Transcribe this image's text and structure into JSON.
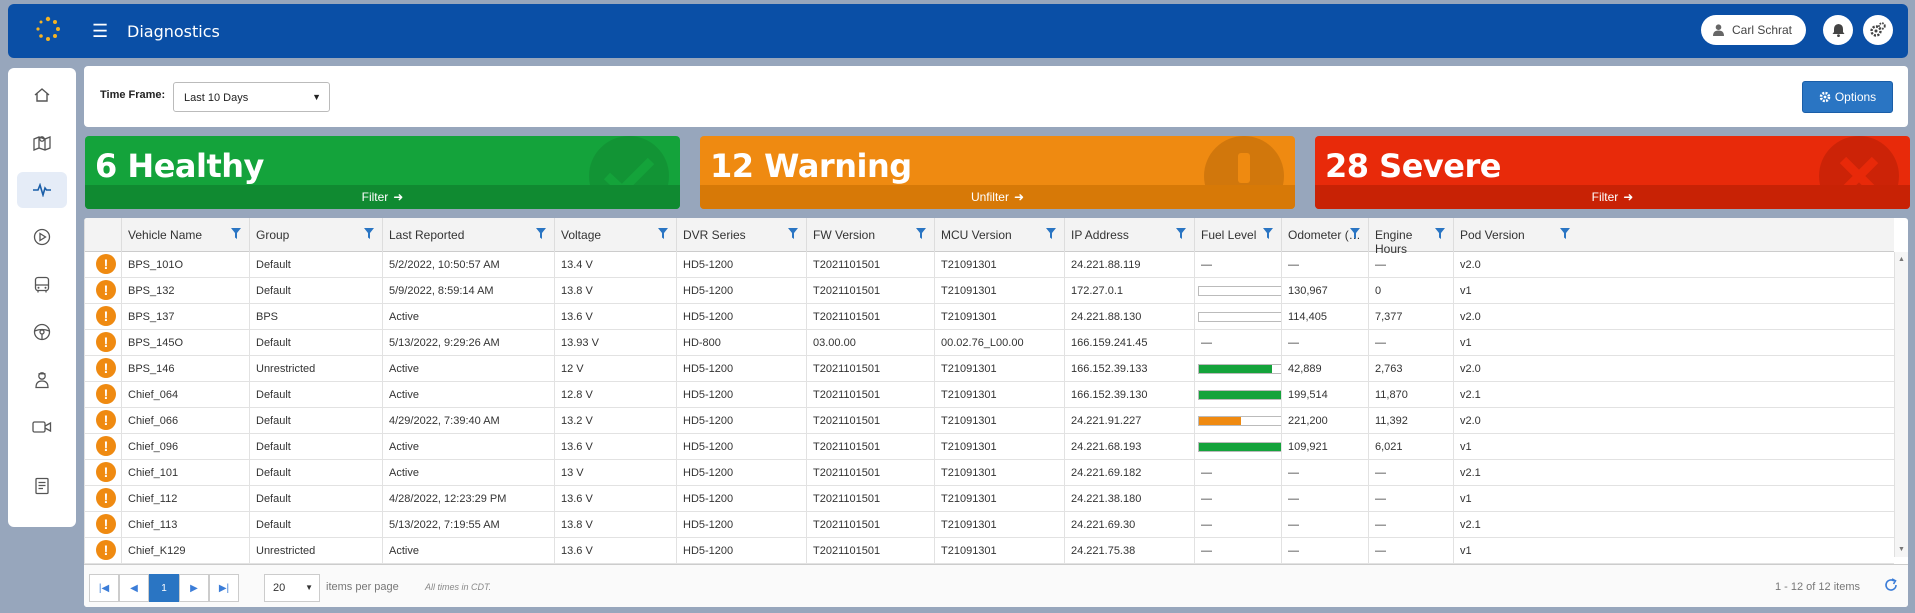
{
  "header": {
    "title": "Diagnostics",
    "user_name": "Carl Schrat",
    "bg": "#0a4fa6"
  },
  "sidebar": {
    "items": [
      "home-icon",
      "map-icon",
      "diagnostics-icon",
      "play-icon",
      "bus-icon",
      "steering-wheel-icon",
      "driver-icon",
      "video-camera-icon",
      "report-icon"
    ],
    "active": "diagnostics-icon"
  },
  "filters": {
    "time_frame_label": "Time Frame:",
    "time_frame_value": "Last 10 Days",
    "options_label": "Options"
  },
  "cards": [
    {
      "title": "6 Healthy",
      "action": "Filter",
      "color": "#14a33b",
      "footer_color": "#108a31"
    },
    {
      "title": "12 Warning",
      "action": "Unfilter",
      "color": "#ef8a11",
      "footer_color": "#d77907"
    },
    {
      "title": "28 Severe",
      "action": "Filter",
      "color": "#e82a0a",
      "footer_color": "#c82205"
    }
  ],
  "grid": {
    "columns": [
      "",
      "Vehicle Name",
      "Group",
      "Last Reported",
      "Voltage",
      "DVR Series",
      "FW Version",
      "MCU Version",
      "IP Address",
      "Fuel Level",
      "Odometer (…",
      "Engine Hours",
      "Pod Version"
    ],
    "rows": [
      {
        "vehicle": "BPS_101O",
        "group": "Default",
        "last": "5/2/2022, 10:50:57 AM",
        "voltage": "13.4 V",
        "dvr": "HD5-1200",
        "fw": "T2021101501",
        "mcu": "T21091301",
        "ip": "24.221.88.119",
        "fuel": null,
        "odometer": "—",
        "hours": "—",
        "pod": "v2.0"
      },
      {
        "vehicle": "BPS_132",
        "group": "Default",
        "last": "5/9/2022, 8:59:14 AM",
        "voltage": "13.8 V",
        "dvr": "HD5-1200",
        "fw": "T2021101501",
        "mcu": "T21091301",
        "ip": "172.27.0.1",
        "fuel": 0,
        "odometer": "130,967",
        "hours": "0",
        "pod": "v1"
      },
      {
        "vehicle": "BPS_137",
        "group": "BPS",
        "last": "Active",
        "voltage": "13.6 V",
        "dvr": "HD5-1200",
        "fw": "T2021101501",
        "mcu": "T21091301",
        "ip": "24.221.88.130",
        "fuel": 0,
        "odometer": "114,405",
        "hours": "7,377",
        "pod": "v2.0"
      },
      {
        "vehicle": "BPS_145O",
        "group": "Default",
        "last": "5/13/2022, 9:29:26 AM",
        "voltage": "13.93 V",
        "dvr": "HD-800",
        "fw": "03.00.00",
        "mcu": "00.02.76_L00.00",
        "ip": "166.159.241.45",
        "fuel": null,
        "odometer": "—",
        "hours": "—",
        "pod": "v1"
      },
      {
        "vehicle": "BPS_146",
        "group": "Unrestricted",
        "last": "Active",
        "voltage": "12 V",
        "dvr": "HD5-1200",
        "fw": "T2021101501",
        "mcu": "T21091301",
        "ip": "166.152.39.133",
        "fuel": 0.74,
        "odometer": "42,889",
        "hours": "2,763",
        "pod": "v2.0"
      },
      {
        "vehicle": "Chief_064",
        "group": "Default",
        "last": "Active",
        "voltage": "12.8 V",
        "dvr": "HD5-1200",
        "fw": "T2021101501",
        "mcu": "T21091301",
        "ip": "166.152.39.130",
        "fuel": 0.99,
        "odometer": "199,514",
        "hours": "11,870",
        "pod": "v2.1"
      },
      {
        "vehicle": "Chief_066",
        "group": "Default",
        "last": "4/29/2022, 7:39:40 AM",
        "voltage": "13.2 V",
        "dvr": "HD5-1200",
        "fw": "T2021101501",
        "mcu": "T21091301",
        "ip": "24.221.91.227",
        "fuel": 0.43,
        "odometer": "221,200",
        "hours": "11,392",
        "pod": "v2.0"
      },
      {
        "vehicle": "Chief_096",
        "group": "Default",
        "last": "Active",
        "voltage": "13.6 V",
        "dvr": "HD5-1200",
        "fw": "T2021101501",
        "mcu": "T21091301",
        "ip": "24.221.68.193",
        "fuel": 0.88,
        "odometer": "109,921",
        "hours": "6,021",
        "pod": "v1"
      },
      {
        "vehicle": "Chief_101",
        "group": "Default",
        "last": "Active",
        "voltage": "13 V",
        "dvr": "HD5-1200",
        "fw": "T2021101501",
        "mcu": "T21091301",
        "ip": "24.221.69.182",
        "fuel": null,
        "odometer": "—",
        "hours": "—",
        "pod": "v2.1"
      },
      {
        "vehicle": "Chief_112",
        "group": "Default",
        "last": "4/28/2022, 12:23:29 PM",
        "voltage": "13.6 V",
        "dvr": "HD5-1200",
        "fw": "T2021101501",
        "mcu": "T21091301",
        "ip": "24.221.38.180",
        "fuel": null,
        "odometer": "—",
        "hours": "—",
        "pod": "v1"
      },
      {
        "vehicle": "Chief_113",
        "group": "Default",
        "last": "5/13/2022, 7:19:55 AM",
        "voltage": "13.8 V",
        "dvr": "HD5-1200",
        "fw": "T2021101501",
        "mcu": "T21091301",
        "ip": "24.221.69.30",
        "fuel": null,
        "odometer": "—",
        "hours": "—",
        "pod": "v2.1"
      },
      {
        "vehicle": "Chief_K129",
        "group": "Unrestricted",
        "last": "Active",
        "voltage": "13.6 V",
        "dvr": "HD5-1200",
        "fw": "T2021101501",
        "mcu": "T21091301",
        "ip": "24.221.75.38",
        "fuel": null,
        "odometer": "—",
        "hours": "—",
        "pod": "v1"
      }
    ],
    "fuel_colors": {
      "high": "#14a33b",
      "low": "#ef8a11"
    },
    "empty_value": "—"
  },
  "pagination": {
    "current_page": "1",
    "page_size": "20",
    "per_page_label": "items per page",
    "tz_note": "All times in CDT.",
    "range_text": "1 - 12 of 12 items"
  }
}
